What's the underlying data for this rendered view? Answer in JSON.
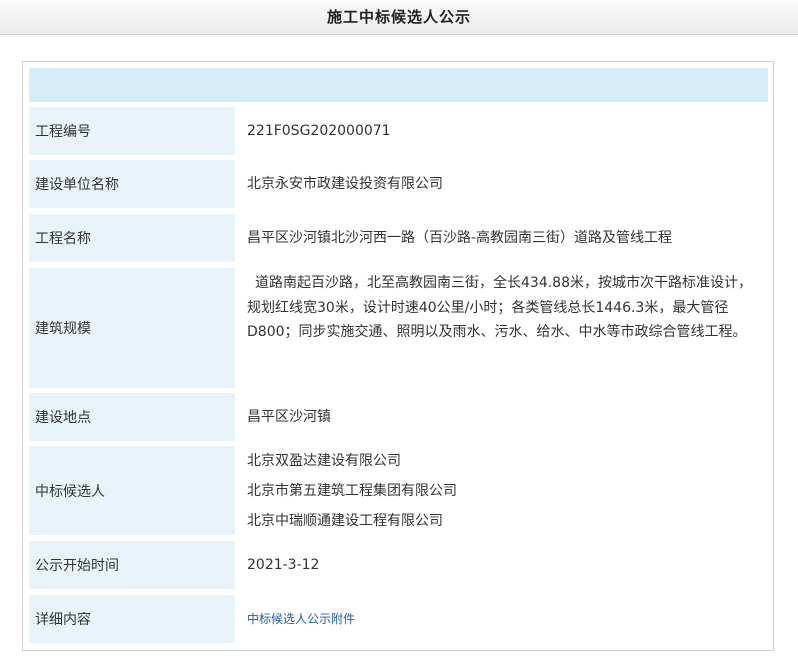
{
  "page": {
    "title": "施工中标候选人公示"
  },
  "rows": {
    "project_no": {
      "label": "工程编号",
      "value": "221F0SG202000071"
    },
    "builder_unit": {
      "label": "建设单位名称",
      "value": "北京永安市政建设投资有限公司"
    },
    "project_name": {
      "label": "工程名称",
      "value": "昌平区沙河镇北沙河西一路（百沙路-高教园南三街）道路及管线工程"
    },
    "scale": {
      "label": "建筑规模",
      "value": "道路南起百沙路，北至高教园南三街，全长434.88米，按城市次干路标准设计，规划红线宽30米，设计时速40公里/小时；各类管线总长1446.3米，最大管径D800；同步实施交通、照明以及雨水、污水、给水、中水等市政综合管线工程。"
    },
    "location": {
      "label": "建设地点",
      "value": "昌平区沙河镇"
    },
    "candidates": {
      "label": "中标候选人",
      "items": [
        "北京双盈达建设有限公司",
        "北京市第五建筑工程集团有限公司",
        "北京中瑞顺通建设工程有限公司"
      ]
    },
    "start_time": {
      "label": "公示开始时间",
      "value": "2021-3-12"
    },
    "details": {
      "label": "详细内容",
      "link_text": "中标候选人公示附件"
    }
  },
  "colors": {
    "label_bg": "#e8f4fa",
    "header_bg": "#d6ecf7",
    "link": "#1f5fa6"
  }
}
